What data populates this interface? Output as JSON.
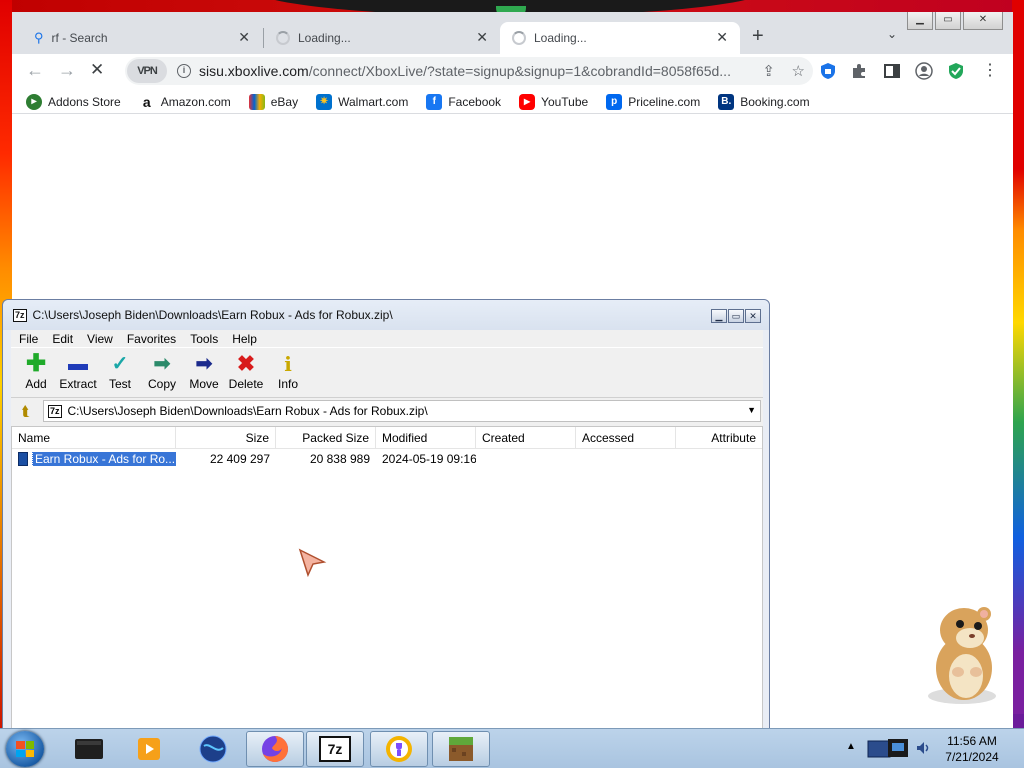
{
  "chrome": {
    "tabs": [
      {
        "label": "rf - Search",
        "icon": "search-icon"
      },
      {
        "label": "Loading...",
        "icon": "spinner-icon"
      },
      {
        "label": "Loading...",
        "icon": "spinner-icon"
      }
    ],
    "url_host": "sisu.xboxlive.com",
    "url_path": "/connect/XboxLive/?state=signup&signup=1&cobrandId=8058f65d...",
    "vpn_label": "VPN",
    "bookmarks": [
      {
        "label": "Addons Store",
        "color": "#2e7d32"
      },
      {
        "label": "Amazon.com",
        "color": "#111111"
      },
      {
        "label": "eBay",
        "color": "#e53238"
      },
      {
        "label": "Walmart.com",
        "color": "#0071ce"
      },
      {
        "label": "Facebook",
        "color": "#1877f2"
      },
      {
        "label": "YouTube",
        "color": "#ff0000"
      },
      {
        "label": "Priceline.com",
        "color": "#0068ef"
      },
      {
        "label": "Booking.com",
        "color": "#003580"
      }
    ]
  },
  "sevenzip": {
    "title": "C:\\Users\\Joseph Biden\\Downloads\\Earn Robux - Ads for Robux.zip\\",
    "menu": [
      "File",
      "Edit",
      "View",
      "Favorites",
      "Tools",
      "Help"
    ],
    "tools": [
      {
        "label": "Add",
        "icon": "add-icon"
      },
      {
        "label": "Extract",
        "icon": "extract-icon"
      },
      {
        "label": "Test",
        "icon": "test-icon"
      },
      {
        "label": "Copy",
        "icon": "copy-icon"
      },
      {
        "label": "Move",
        "icon": "move-icon"
      },
      {
        "label": "Delete",
        "icon": "delete-icon"
      },
      {
        "label": "Info",
        "icon": "info-icon"
      }
    ],
    "address": "C:\\Users\\Joseph Biden\\Downloads\\Earn Robux - Ads for Robux.zip\\",
    "columns": [
      "Name",
      "Size",
      "Packed Size",
      "Modified",
      "Created",
      "Accessed",
      "Attribute"
    ],
    "rows": [
      {
        "name": "Earn Robux - Ads for Ro...",
        "size": "22 409 297",
        "packed": "20 838 989",
        "modified": "2024-05-19 09:16",
        "created": "",
        "accessed": "",
        "attr": ""
      }
    ]
  },
  "taskbar": {
    "time": "11:56 AM",
    "date": "7/21/2024",
    "zip_label": "7z"
  }
}
